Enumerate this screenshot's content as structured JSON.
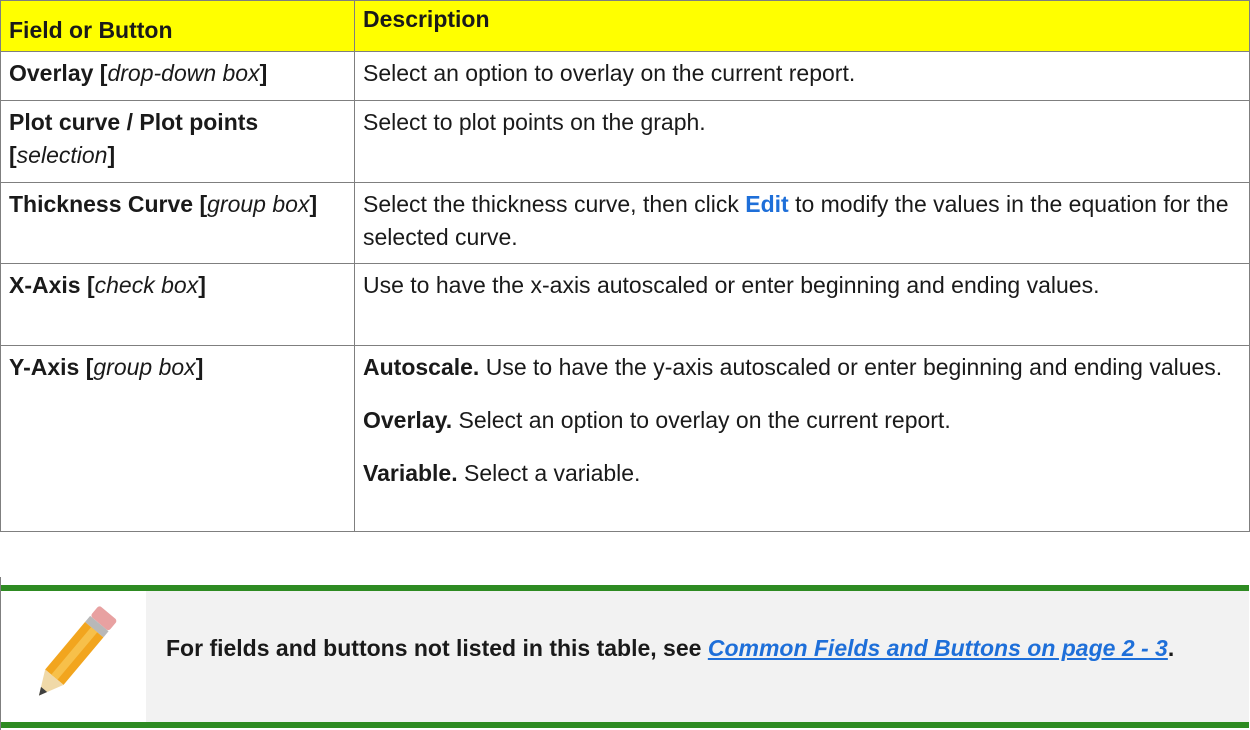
{
  "table": {
    "headers": [
      "Field or Button",
      "Description"
    ],
    "rows": [
      {
        "field_bold": "Overlay [",
        "field_italic": "drop-down box",
        "field_close": "]",
        "description": "Select an option to overlay on the current report."
      },
      {
        "field_bold": "Plot curve / Plot points [",
        "field_italic": "selection",
        "field_close": "]",
        "description": "Select to plot points on the graph."
      },
      {
        "field_bold": "Thickness Curve [",
        "field_italic": "group box",
        "field_close": "]",
        "description_before": "Select the thickness curve, then click ",
        "description_link": "Edit",
        "description_after": " to modify the values in the equation for the selected curve."
      },
      {
        "field_bold": "X-Axis [",
        "field_italic": "check box",
        "field_close": "]",
        "description": "Use to have the x-axis autoscaled or enter beginning and ending values."
      },
      {
        "field_bold": "Y-Axis [",
        "field_italic": "group box",
        "field_close": "]",
        "paragraphs": [
          {
            "lead": "Autoscale.",
            "text": " Use to have the y-axis autoscaled or enter beginning and ending values."
          },
          {
            "lead": "Overlay.",
            "text": " Select an option to overlay on the current report."
          },
          {
            "lead": "Variable.",
            "text": " Select a variable."
          }
        ]
      }
    ]
  },
  "note": {
    "icon": "pencil-icon",
    "text_before": "For fields and buttons not listed in this table, see ",
    "link_text": "Common Fields and Buttons on page 2 - 3",
    "text_after": "."
  },
  "colors": {
    "header_background": "#ffff00",
    "note_bar": "#2e8b22",
    "note_background": "#f2f2f2",
    "link": "#1e6fd9"
  }
}
